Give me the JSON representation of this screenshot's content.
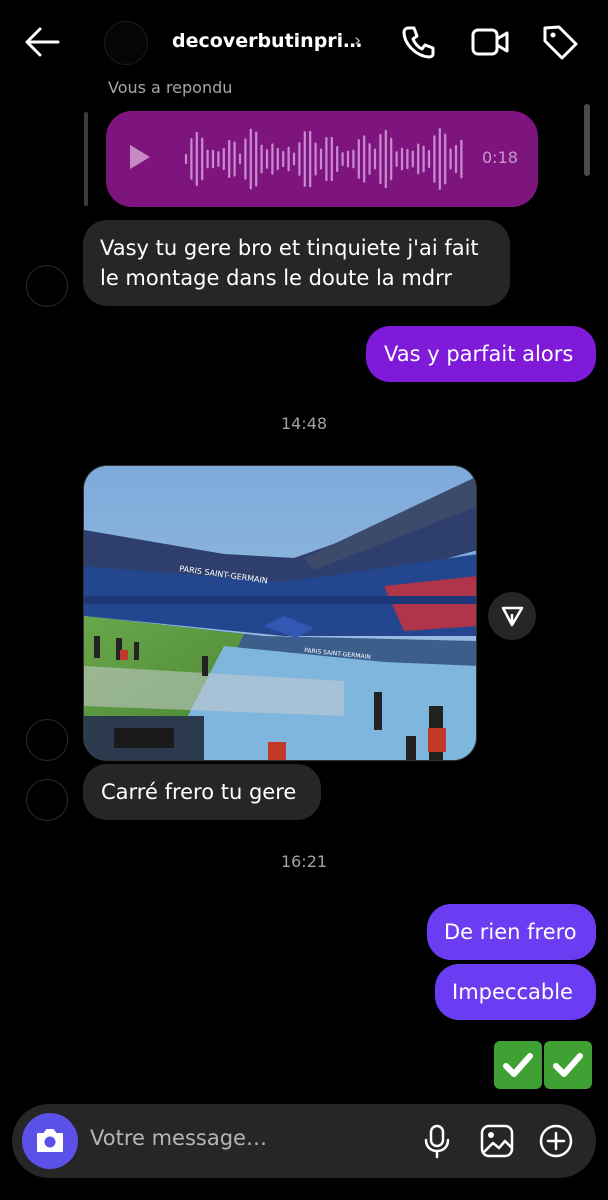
{
  "header": {
    "username": "decoverbutinpri…",
    "chevron": "›"
  },
  "thread": {
    "reply_label": "Vous a repondu",
    "voice_duration": "0:18",
    "messages": [
      {
        "from": "them",
        "text_line1": "Vasy tu gere bro et tinquiete j'ai fait",
        "text_line2": "le montage dans le doute la mdrr"
      },
      {
        "from": "me",
        "text": "Vas y parfait alors"
      },
      {
        "from": "them",
        "text": "Carré frero tu gere"
      },
      {
        "from": "me",
        "text": "De rien frero"
      },
      {
        "from": "me",
        "text": "Impeccable"
      }
    ],
    "timestamps": [
      "14:48",
      "16:21"
    ],
    "photo_texts": [
      "PARIS SAINT-GERMAIN",
      "PARIS SAINT-GERMAIN"
    ],
    "reaction_emojis": "✅✅"
  },
  "composer": {
    "placeholder": "Votre message…"
  },
  "colors": {
    "outgoing_purple": "#7f1ad9",
    "outgoing_violet": "#6b3cf2",
    "incoming": "#262626",
    "voice_bubble": "#7e157e",
    "camera_button": "#5b51e8"
  },
  "icons": [
    "back-arrow-icon",
    "phone-icon",
    "video-camera-icon",
    "tag-icon",
    "play-icon",
    "share-icon",
    "camera-icon",
    "microphone-icon",
    "image-icon",
    "plus-circle-icon"
  ]
}
